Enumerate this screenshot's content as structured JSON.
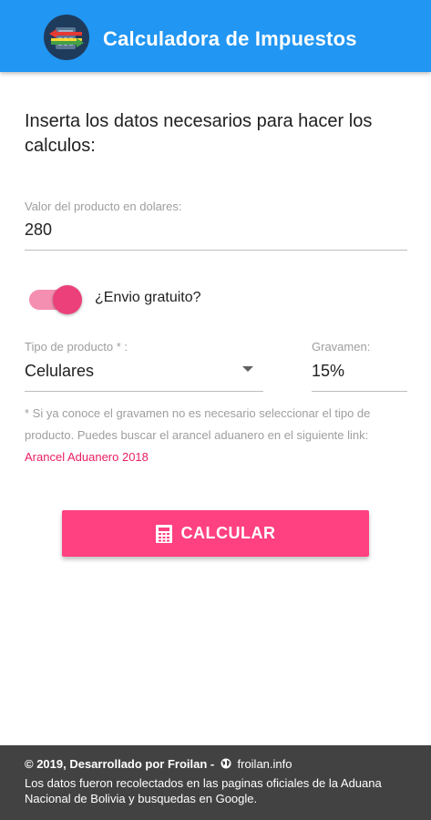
{
  "app": {
    "title": "Calculadora de Impuestos"
  },
  "intro": "Inserta los datos necesarios para hacer los calculos:",
  "precio": {
    "label": "Valor del producto en dolares:",
    "value": "280"
  },
  "envio": {
    "label": "¿Envio gratuito?",
    "checked": true
  },
  "tipo_producto": {
    "label": "Tipo de producto * :",
    "value": "Celulares"
  },
  "gravamen": {
    "label": "Gravamen:",
    "value": "15%"
  },
  "note": {
    "text": "* Si ya conoce el gravamen no es necesario seleccionar el tipo de producto. Puedes buscar el arancel aduanero en el siguiente link: ",
    "link": "Arancel Aduanero 2018"
  },
  "calcular_label": "CALCULAR",
  "footer": {
    "credit": "© 2019, Desarrollado por Froilan -",
    "site": "froilan.info",
    "text": "Los datos fueron recolectados en las paginas oficiales de la Aduana Nacional de Bolivia y busquedas en Google."
  },
  "colors": {
    "appbar": "#2196f3",
    "accent": "#ff4081",
    "footer": "#424242"
  }
}
